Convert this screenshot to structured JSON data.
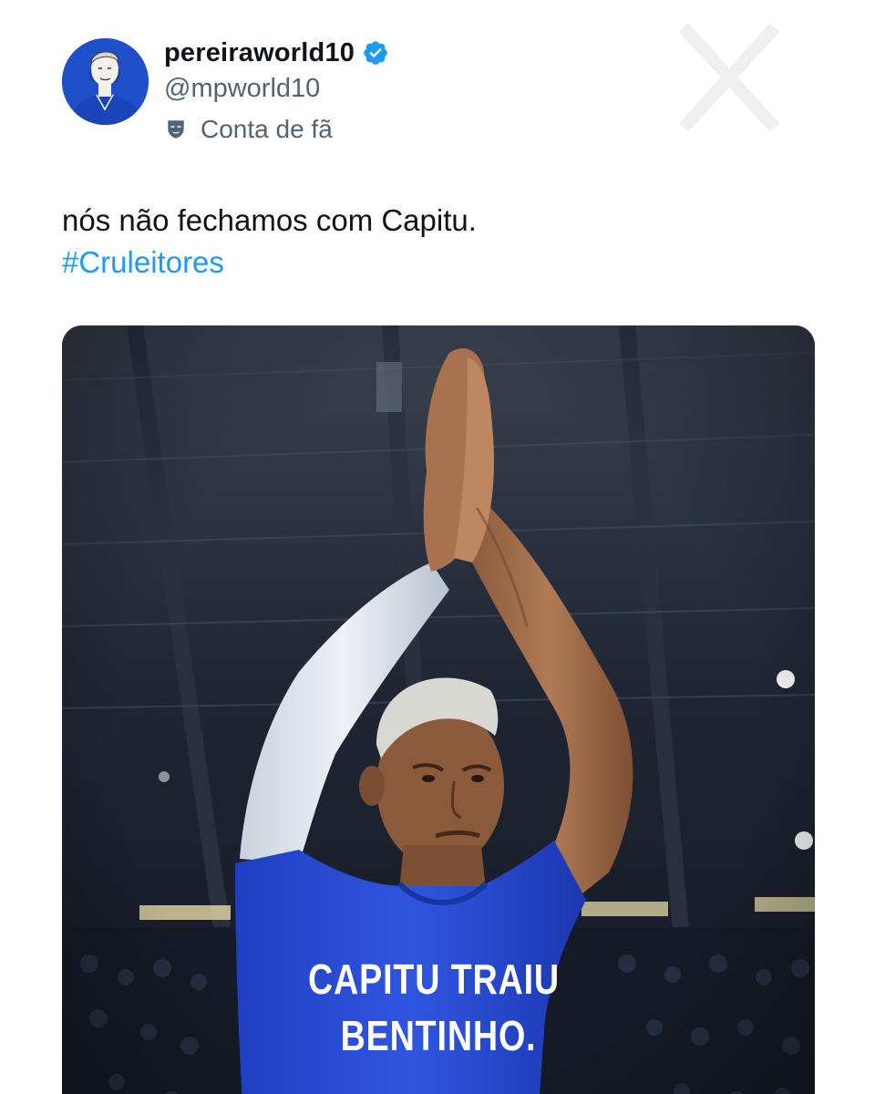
{
  "author": {
    "display_name": "pereiraworld10",
    "handle": "@mpworld10",
    "badge": "Conta de fã",
    "verified_icon": "verified-badge-icon",
    "badge_icon": "theater-mask-icon",
    "verified_color": "#1d9bf0"
  },
  "tweet": {
    "text": "nós não fechamos com Capitu.",
    "hashtag": "#Cruleitores",
    "hashtag_color": "#1d9bf0"
  },
  "media": {
    "shirt_text_line_1": "CAPITU TRAIU",
    "shirt_text_line_2": "BENTINHO."
  }
}
